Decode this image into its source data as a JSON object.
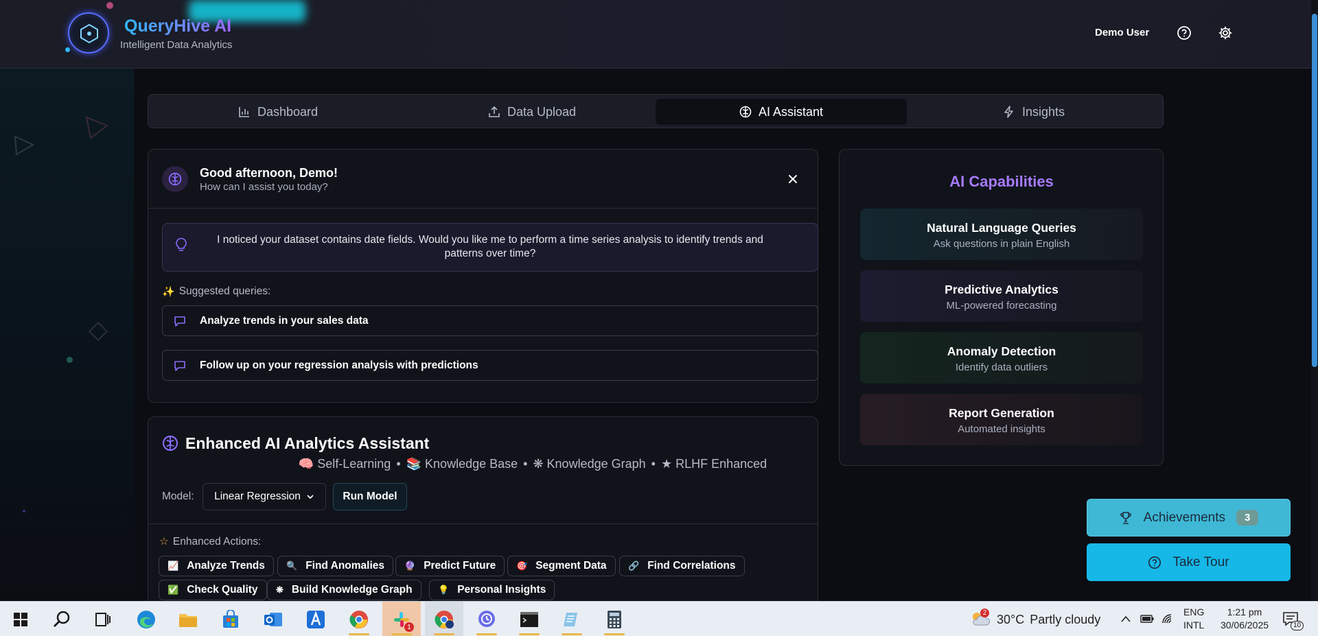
{
  "app": {
    "name": "QueryHive AI",
    "tagline": "Intelligent Data Analytics",
    "user": "Demo User"
  },
  "tabs": [
    {
      "label": "Dashboard",
      "icon": "bar-chart-icon"
    },
    {
      "label": "Data Upload",
      "icon": "upload-icon"
    },
    {
      "label": "AI Assistant",
      "icon": "brain-icon",
      "active": true
    },
    {
      "label": "Insights",
      "icon": "lightning-icon"
    }
  ],
  "greeting": {
    "title": "Good afternoon, Demo!",
    "subtitle": "How can I assist you today?",
    "notice": "I noticed your dataset contains date fields. Would you like me to perform a time series analysis to identify trends and patterns over time?",
    "suggested_heading": "Suggested queries:",
    "suggestions": [
      "Analyze trends in your sales data",
      "Follow up on your regression analysis with predictions"
    ]
  },
  "capabilities": {
    "title": "AI Capabilities",
    "items": [
      {
        "title": "Natural Language Queries",
        "subtitle": "Ask questions in plain English",
        "bg": "#14262e"
      },
      {
        "title": "Predictive Analytics",
        "subtitle": "ML-powered forecasting",
        "bg": "#1d1c30"
      },
      {
        "title": "Anomaly Detection",
        "subtitle": "Identify data outliers",
        "bg": "#14251f"
      },
      {
        "title": "Report Generation",
        "subtitle": "Automated insights",
        "bg": "#261c24"
      }
    ]
  },
  "assistant": {
    "title": "Enhanced AI Analytics Assistant",
    "tags": [
      "🧠 Self-Learning",
      "•",
      "📚 Knowledge Base",
      "•",
      "❋ Knowledge Graph",
      "•",
      "★ RLHF Enhanced"
    ],
    "model_label": "Model:",
    "model_value": "Linear Regression",
    "run_label": "Run Model",
    "actions_heading": "Enhanced Actions:",
    "actions": [
      {
        "icon": "📈",
        "label": "Analyze Trends"
      },
      {
        "icon": "🔍",
        "label": "Find Anomalies"
      },
      {
        "icon": "🔮",
        "label": "Predict Future"
      },
      {
        "icon": "🎯",
        "label": "Segment Data"
      },
      {
        "icon": "🔗",
        "label": "Find Correlations"
      },
      {
        "icon": "✅",
        "label": "Check Quality"
      },
      {
        "icon": "❋",
        "label": "Build Knowledge Graph"
      },
      {
        "icon": "💡",
        "label": "Personal Insights"
      }
    ]
  },
  "floating": {
    "achievements_label": "Achievements",
    "achievements_count": "3",
    "tour_label": "Take Tour"
  },
  "taskbar": {
    "weather_temp": "30°C",
    "weather_desc": "Partly cloudy",
    "weather_badge": "2",
    "lang1": "ENG",
    "lang2": "INTL",
    "time": "1:21 pm",
    "date": "30/06/2025",
    "notif_count": "10",
    "slack_badge": "1"
  },
  "colors": {
    "accent_purple": "#a67bff",
    "accent_cyan": "#16b8e8",
    "achievements_bg": "#3fb8d6"
  }
}
